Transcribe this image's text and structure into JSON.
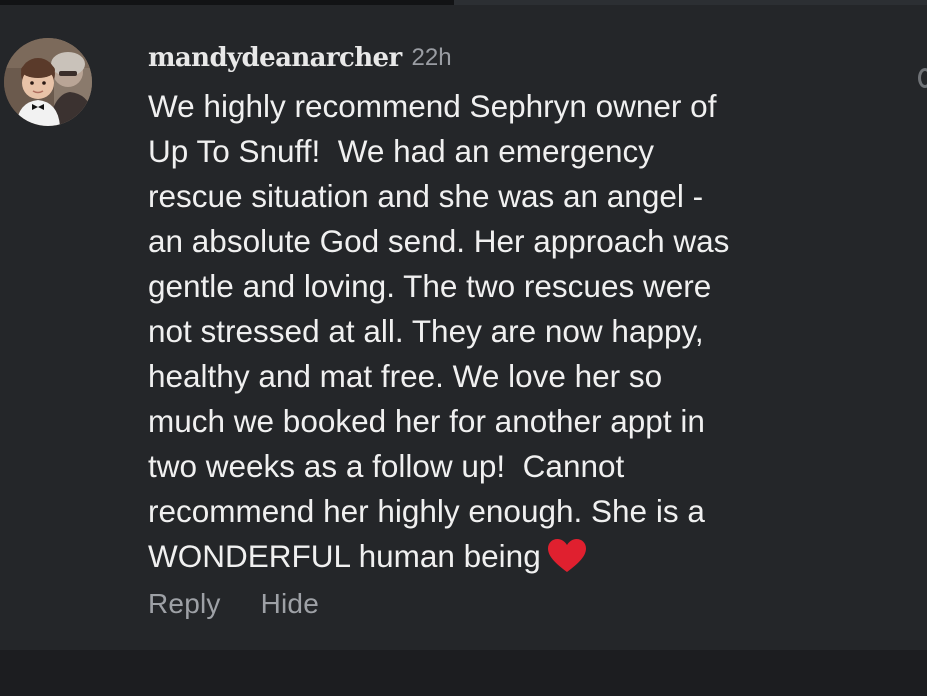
{
  "window": {
    "scroll_progress": 0.49
  },
  "comment": {
    "username": "mandydeanarcher",
    "timestamp": "22h",
    "avatar_icon": "user-avatar-photo",
    "text_lines": [
      "We highly recommend Sephryn owner of",
      "Up To Snuff!  We had an emergency",
      "rescue situation and she was an angel -",
      "an absolute God send. Her approach was",
      "gentle and loving. The two rescues were",
      "not stressed at all. They are now happy,",
      "healthy and mat free. We love her so",
      "much we booked her for another appt in",
      "two weeks as a follow up!  Cannot",
      "recommend her highly enough. She is a",
      "WONDERFUL human being"
    ],
    "trailing_emoji": "red-heart-icon",
    "heart_color": "#e0202f"
  },
  "actions": {
    "reply_label": "Reply",
    "hide_label": "Hide"
  },
  "colors": {
    "background": "#242629",
    "text": "#f0f0f0",
    "muted": "#9ea1a6"
  }
}
